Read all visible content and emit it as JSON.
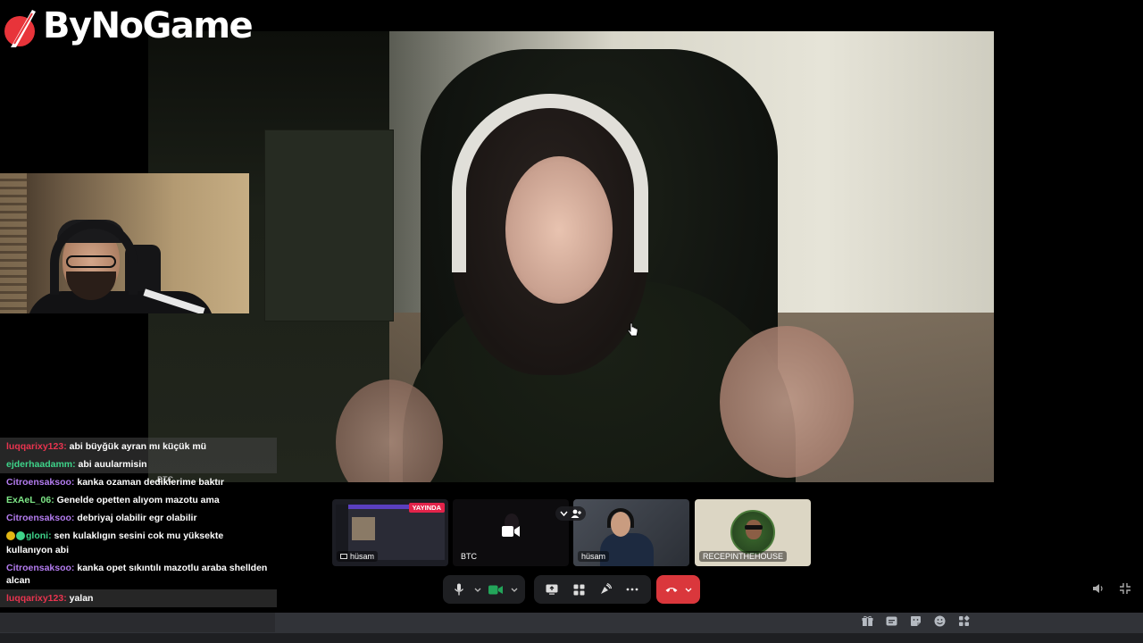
{
  "brand": {
    "name": "ByNoGame",
    "accent": "#e8343a"
  },
  "chat": {
    "messages": [
      {
        "user": "luqqarixy123:",
        "color": "#e8344f",
        "text": " abi büyğük ayran mı küçük mü",
        "highlight": true
      },
      {
        "user": "ejderhaadamm:",
        "color": "#3ed48a",
        "text": " abi auularmisin",
        "highlight": true
      },
      {
        "user": "Citroensaksoo:",
        "color": "#b47cf0",
        "text": " kanka ozaman dediklerime baktır",
        "highlight": false
      },
      {
        "user": "ExAeL_06:",
        "color": "#7ee787",
        "text": " Genelde opetten alıyom mazotu ama",
        "highlight": false
      },
      {
        "user": "Citroensaksoo:",
        "color": "#b47cf0",
        "text": " debriyaj olabilir egr olabilir",
        "highlight": false
      },
      {
        "user": "gloni:",
        "color": "#3ed48a",
        "text": " sen kulaklıgın sesini cok mu yüksekte kullanıyon abi",
        "highlight": false,
        "badges": [
          "#e2b714",
          "#3ed48a"
        ]
      },
      {
        "user": "Citroensaksoo:",
        "color": "#b47cf0",
        "text": " kanka opet sıkıntılı mazotlu araba shellden alcan",
        "highlight": false
      },
      {
        "user": "luqqarixy123:",
        "color": "#e8344f",
        "text": " yalan",
        "highlight": true
      }
    ]
  },
  "stage": {
    "overlay_label": "BTC"
  },
  "participants": [
    {
      "name": "hüsam",
      "live_label": "YAYINDA"
    },
    {
      "name": "BTC"
    },
    {
      "name": "hüsam"
    },
    {
      "name": "RECEPINTHEHOUSE"
    }
  ],
  "controls": {
    "mic_icon": "microphone-icon",
    "camera_icon": "video-camera-icon",
    "screen_share_icon": "screen-share-icon",
    "activities_icon": "activities-icon",
    "soundboard_icon": "soundboard-icon",
    "more_icon": "more-options-icon",
    "hangup_icon": "hang-up-icon",
    "hangup_color": "#da373c"
  },
  "bottom_icons": [
    "gift-icon",
    "gif-icon",
    "sticker-icon",
    "emoji-icon",
    "apps-icon"
  ]
}
